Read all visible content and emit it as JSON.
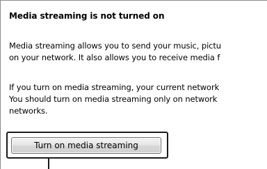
{
  "panel": {
    "heading": "Media streaming is not turned on",
    "paragraph1": [
      "Media streaming allows you to send your music, pictu",
      "on your network.  It also allows you to receive media f"
    ],
    "paragraph2": [
      "If you turn on media streaming, your current network",
      "You should turn on media streaming only on network",
      "networks."
    ],
    "button_label": "Turn on media streaming"
  }
}
